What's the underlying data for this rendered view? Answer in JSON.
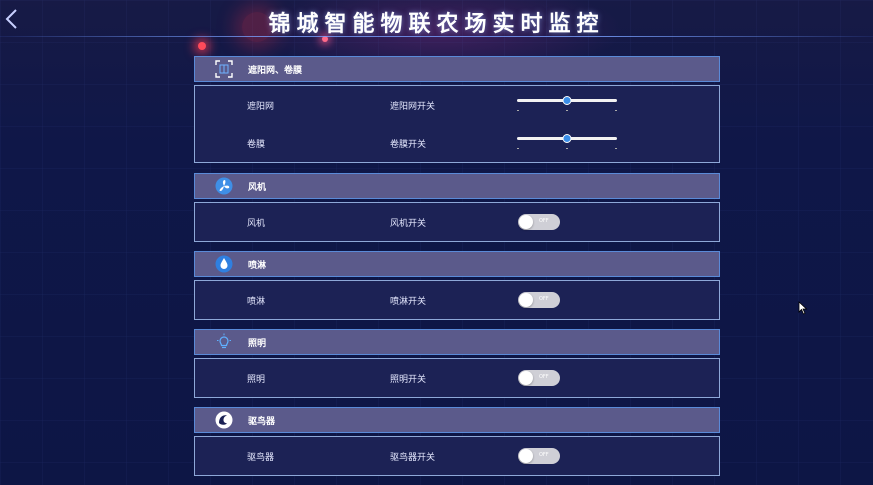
{
  "header": {
    "title": "锦城智能物联农场实时监控"
  },
  "sections": [
    {
      "title": "遮阳网、卷膜",
      "icon": "scan-frame-icon",
      "rows": [
        {
          "name": "遮阳网",
          "switch_label": "遮阳网开关",
          "control": "slider",
          "value": 0.5
        },
        {
          "name": "卷膜",
          "switch_label": "卷膜开关",
          "control": "slider",
          "value": 0.5
        }
      ]
    },
    {
      "title": "风机",
      "icon": "fan-icon",
      "rows": [
        {
          "name": "风机",
          "switch_label": "风机开关",
          "control": "toggle",
          "state": "OFF"
        }
      ]
    },
    {
      "title": "喷淋",
      "icon": "water-drop-icon",
      "rows": [
        {
          "name": "喷淋",
          "switch_label": "喷淋开关",
          "control": "toggle",
          "state": "OFF"
        }
      ]
    },
    {
      "title": "照明",
      "icon": "light-bulb-icon",
      "rows": [
        {
          "name": "照明",
          "switch_label": "照明开关",
          "control": "toggle",
          "state": "OFF"
        }
      ]
    },
    {
      "title": "驱鸟器",
      "icon": "bird-repeller-icon",
      "rows": [
        {
          "name": "驱鸟器",
          "switch_label": "驱鸟器开关",
          "control": "toggle",
          "state": "OFF"
        }
      ]
    }
  ],
  "colors": {
    "section_header": "#5b5a8b",
    "section_body": "#1c2255",
    "slider_thumb": "#3a8ee8",
    "toggle_off": "#cfcfd6"
  }
}
